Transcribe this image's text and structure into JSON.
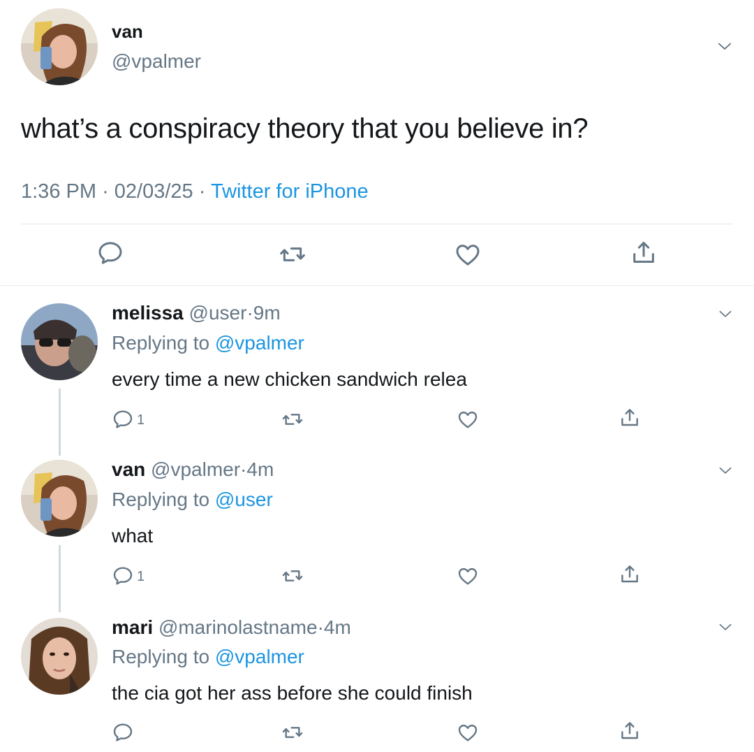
{
  "main_tweet": {
    "name": "van",
    "handle": "@vpalmer",
    "text": "what’s a conspiracy theory that you believe in?",
    "time": "1:36 PM",
    "date": "02/03/25",
    "separator": "·",
    "source": "Twitter for iPhone"
  },
  "replies": [
    {
      "name": "melissa",
      "handle": "@user",
      "time": "9m",
      "replying_prefix": "Replying to",
      "replying_to": "@vpalmer",
      "text": "every time a new chicken sandwich relea",
      "reply_count": "1"
    },
    {
      "name": "van",
      "handle": "@vpalmer",
      "time": "4m",
      "replying_prefix": "Replying to",
      "replying_to": "@user",
      "text": "what",
      "reply_count": "1"
    },
    {
      "name": "mari",
      "handle": "@marinolastname",
      "time": "4m",
      "replying_prefix": "Replying to",
      "replying_to": "@vpalmer",
      "text": "the cia got her ass before she could finish",
      "reply_count": ""
    }
  ],
  "icons": [
    "reply-icon",
    "retweet-icon",
    "like-icon",
    "share-icon",
    "chevron-down-icon"
  ],
  "colors": {
    "text": "#14171a",
    "secondary": "#657786",
    "link": "#1b95e0",
    "divider": "#e1e8ed"
  }
}
